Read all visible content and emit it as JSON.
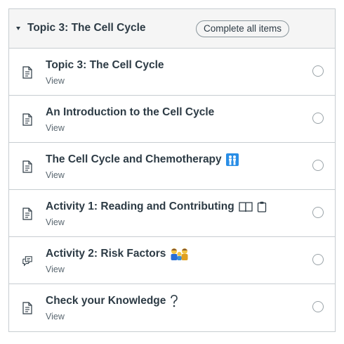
{
  "module": {
    "title": "Topic 3: The Cell Cycle",
    "complete_label": "Complete all items"
  },
  "items": [
    {
      "title": "Topic 3: The Cell Cycle",
      "sub": "View",
      "icon": "page-icon"
    },
    {
      "title": "An Introduction to the Cell Cycle",
      "sub": "View",
      "icon": "page-icon"
    },
    {
      "title": "The Cell Cycle and Chemotherapy",
      "sub": "View",
      "icon": "page-icon",
      "emoji": "people-grid-emoji"
    },
    {
      "title": "Activity 1: Reading and Contributing",
      "sub": "View",
      "icon": "page-icon",
      "emoji": "book-clipboard-emoji"
    },
    {
      "title": "Activity 2: Risk Factors",
      "sub": "View",
      "icon": "discussion-icon",
      "emoji": "family-emoji"
    },
    {
      "title": "Check your Knowledge",
      "sub": "View",
      "icon": "page-icon",
      "emoji": "question-emoji"
    }
  ]
}
